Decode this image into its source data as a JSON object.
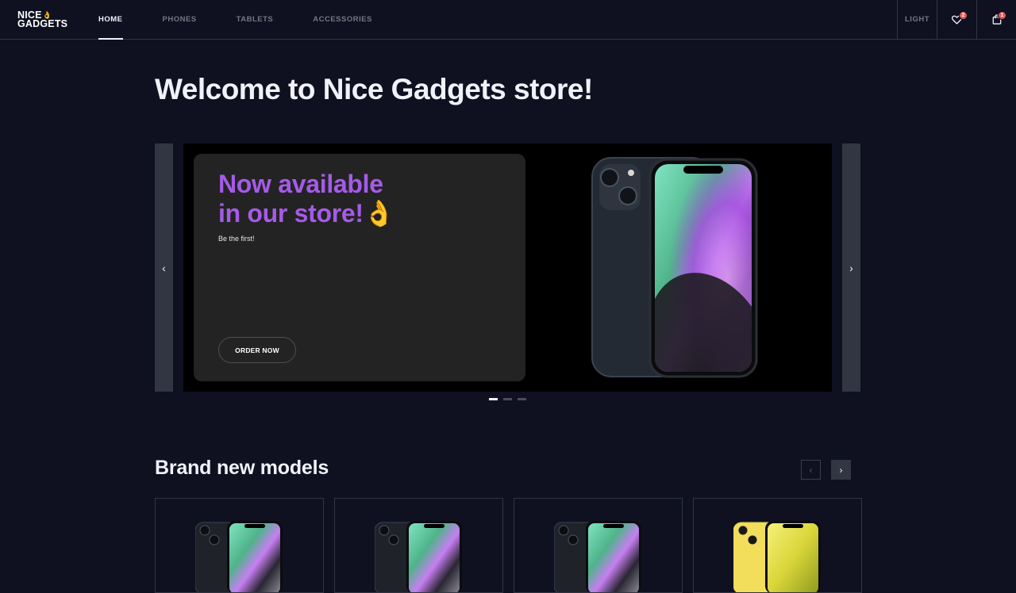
{
  "header": {
    "logo_line1": "NICE",
    "logo_line2": "GADGETS",
    "logo_glyph": "👌",
    "nav": [
      {
        "label": "HOME",
        "active": true
      },
      {
        "label": "PHONES",
        "active": false
      },
      {
        "label": "TABLETS",
        "active": false
      },
      {
        "label": "ACCESSORIES",
        "active": false
      }
    ],
    "theme_label": "LIGHT",
    "favourites_count": "2",
    "cart_count": "1",
    "favourites_icon": "heart-icon",
    "cart_icon": "shopping-bag-icon"
  },
  "main": {
    "title": "Welcome to Nice Gadgets store!"
  },
  "banner": {
    "headline_line1": "Now available",
    "headline_line2": "in our store!",
    "headline_emoji": "👌",
    "subtitle": "Be the first!",
    "cta_label": "ORDER NOW",
    "prev_icon": "‹",
    "next_icon": "›",
    "slides_total": 3,
    "active_slide": 1
  },
  "new_models": {
    "title": "Brand new models",
    "prev_icon": "‹",
    "next_icon": "›",
    "products": [
      {
        "color": "#1f2229",
        "screen": "green-purple"
      },
      {
        "color": "#1f2229",
        "screen": "green-purple"
      },
      {
        "color": "#1f2229",
        "screen": "green-purple"
      },
      {
        "color": "#f3de5c",
        "screen": "yellow"
      }
    ]
  },
  "colors": {
    "background": "#0f1121",
    "accent_purple": "#a55be8",
    "border": "#323542",
    "badge": "#eb5757"
  }
}
